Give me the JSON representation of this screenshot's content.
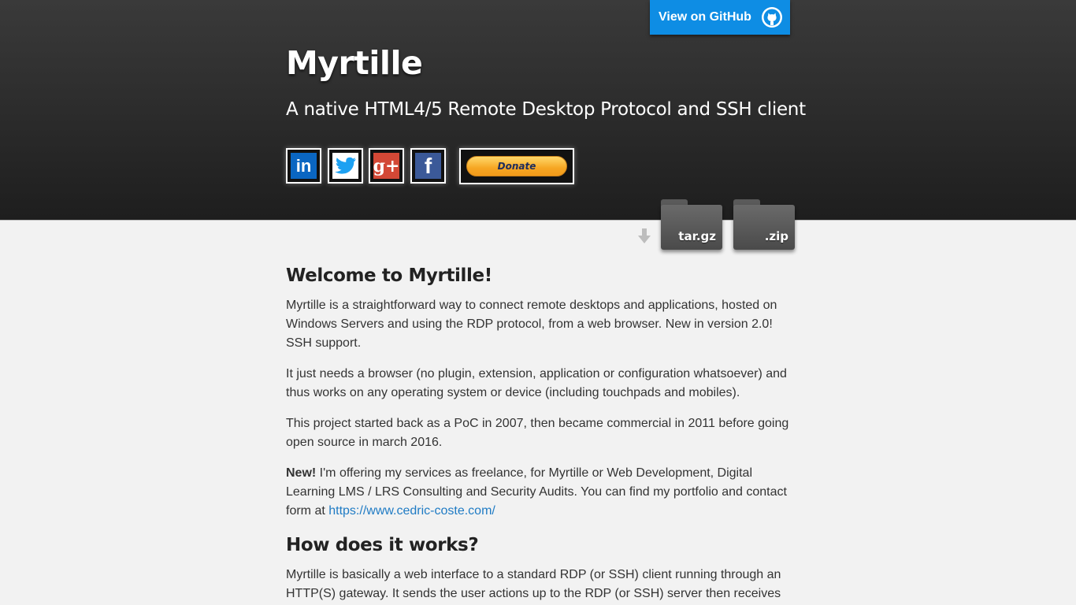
{
  "header": {
    "github_label": "View on GitHub",
    "title": "Myrtille",
    "subtitle": "A native HTML4/5 Remote Desktop Protocol and SSH client",
    "social": [
      {
        "name": "linkedin",
        "glyph": "in",
        "color": "#0a66c2"
      },
      {
        "name": "twitter",
        "glyph": "t",
        "color": "#1da1f2"
      },
      {
        "name": "google-plus",
        "glyph": "g+",
        "color": "#d34836"
      },
      {
        "name": "facebook",
        "glyph": "f",
        "color": "#3b5998"
      }
    ],
    "donate_label": "Donate"
  },
  "downloads": {
    "tar_label": "tar.gz",
    "zip_label": ".zip"
  },
  "content": {
    "welcome_heading": "Welcome to Myrtille!",
    "p1": "Myrtille is a straightforward way to connect remote desktops and applications, hosted on Windows Servers and using the RDP protocol, from a web browser. New in version 2.0! SSH support.",
    "p2": "It just needs a browser (no plugin, extension, application or configuration whatsoever) and thus works on any operating system or device (including touchpads and mobiles).",
    "p3": "This project started back as a PoC in 2007, then became commercial in 2011 before going open source in march 2016.",
    "p4_bold": "New!",
    "p4_text": " I'm offering my services as freelance, for Myrtille or Web Development, Digital Learning LMS / LRS Consulting and Security Audits. You can find my portfolio and contact form at ",
    "p4_link": "https://www.cedric-coste.com/",
    "how_heading": "How does it works?",
    "p5": "Myrtille is basically a web interface to a standard RDP (or SSH) client running through an HTTP(S) gateway. It sends the user actions up to the RDP (or SSH) server then receives"
  },
  "colors": {
    "github_blue": "#0e8de4",
    "link": "#1f7bc4"
  }
}
